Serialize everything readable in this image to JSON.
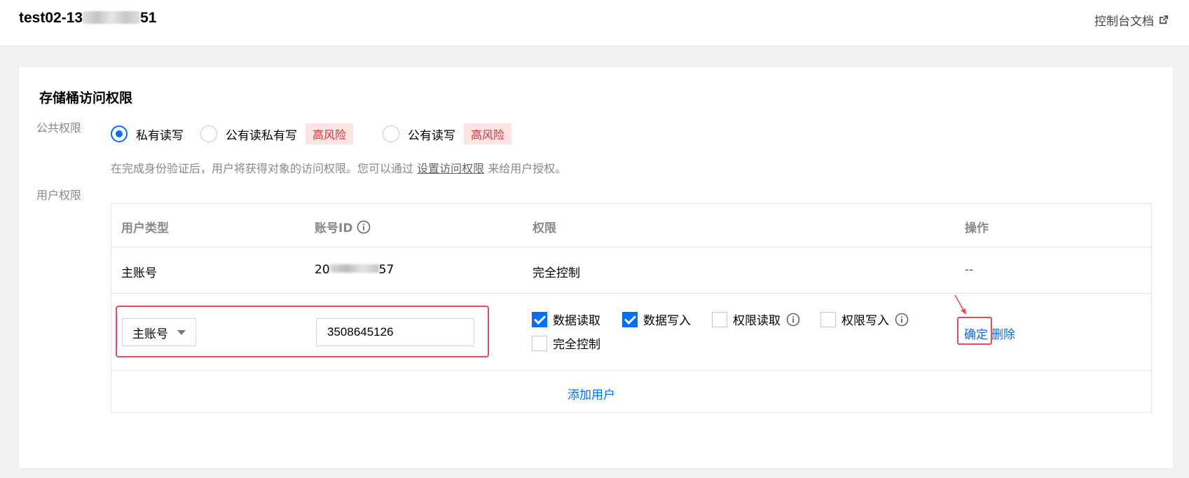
{
  "header": {
    "bucket_prefix": "test02-13",
    "bucket_suffix": "51",
    "doc_link": "控制台文档"
  },
  "section": {
    "title": "存储桶访问权限"
  },
  "public_permission": {
    "label": "公共权限",
    "options": [
      {
        "label": "私有读写",
        "selected": true
      },
      {
        "label": "公有读私有写",
        "selected": false,
        "badge": "高风险"
      },
      {
        "label": "公有读写",
        "selected": false,
        "badge": "高风险"
      }
    ],
    "hint_prefix": "在完成身份验证后，用户将获得对象的访问权限。您可以通过",
    "hint_link": "设置访问权限",
    "hint_suffix": "来给用户授权。"
  },
  "user_permission": {
    "label": "用户权限",
    "columns": [
      "用户类型",
      "账号ID",
      "权限",
      "操作"
    ],
    "rows": [
      {
        "type": "主账号",
        "id_prefix": "20",
        "id_suffix": "57",
        "permission": "完全控制",
        "action": "--"
      }
    ],
    "edit_row": {
      "type_selected": "主账号",
      "account_id": "3508645126",
      "permissions": [
        {
          "label": "数据读取",
          "checked": true,
          "info": false
        },
        {
          "label": "数据写入",
          "checked": true,
          "info": false
        },
        {
          "label": "权限读取",
          "checked": false,
          "info": true
        },
        {
          "label": "权限写入",
          "checked": false,
          "info": true
        },
        {
          "label": "完全控制",
          "checked": false,
          "info": false
        }
      ],
      "confirm": "确定",
      "delete": "删除"
    },
    "add_user": "添加用户"
  },
  "colors": {
    "primary": "#006eff",
    "risk_bg": "#fde4e4",
    "risk_text": "#d0323b",
    "highlight": "#e84a5f"
  }
}
